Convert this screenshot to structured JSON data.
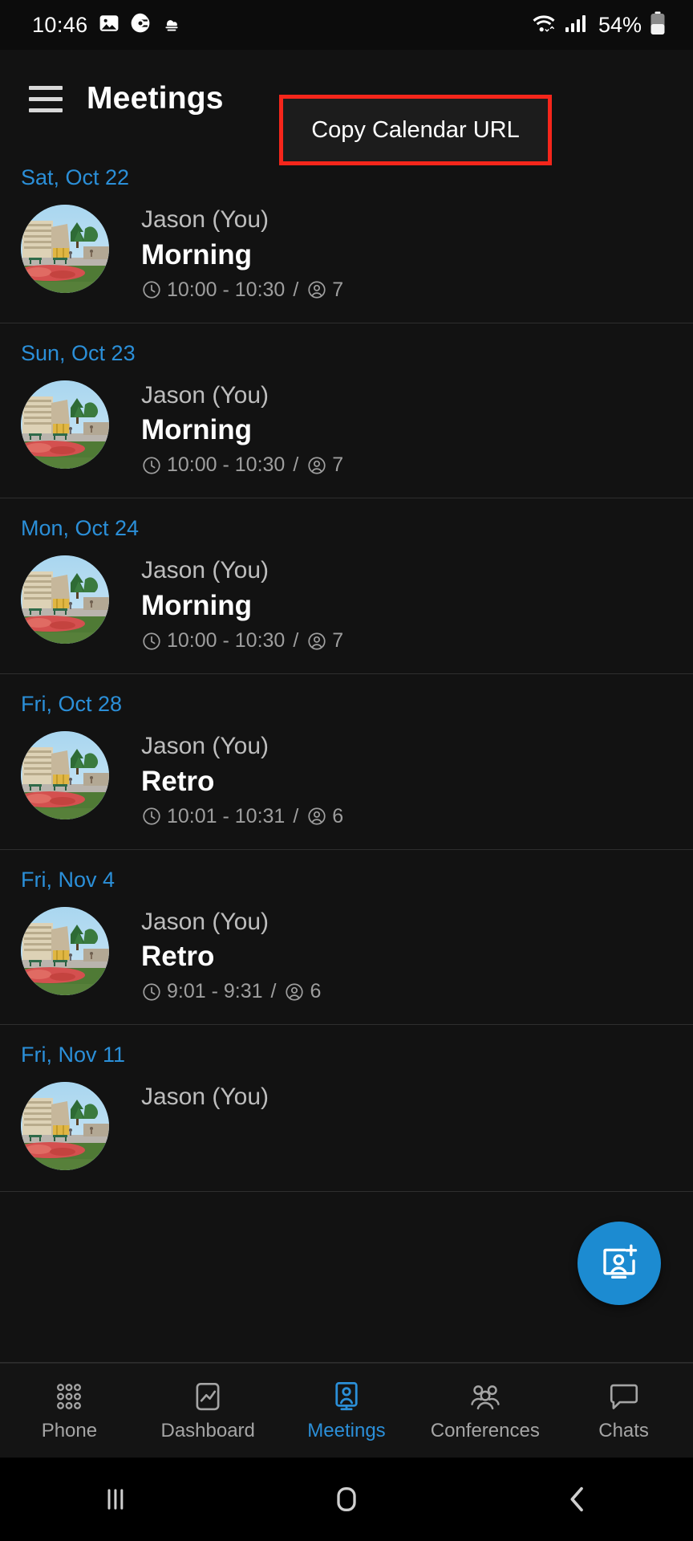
{
  "status_bar": {
    "time": "10:46",
    "battery_percent": "54%",
    "left_icons": [
      "image-icon",
      "chrome-icon",
      "cloud-icon"
    ],
    "right_icons": [
      "wifi-icon",
      "cellular-signal-icon",
      "battery-icon"
    ]
  },
  "app_bar": {
    "menu_icon": "hamburger-menu-icon",
    "title": "Meetings",
    "copy_calendar_url_label": "Copy Calendar URL",
    "highlight_color": "#f5261b"
  },
  "colors": {
    "accent": "#2b8fd8",
    "background": "#121212",
    "card": "#1c1c1c",
    "fab": "#1c8bd1",
    "divider": "#2e2e2e"
  },
  "meetings": [
    {
      "date": "Sat, Oct 22",
      "organizer": "Jason (You)",
      "subject": "Morning",
      "time": "10:00 - 10:30",
      "separator": "/",
      "participants": "7"
    },
    {
      "date": "Sun, Oct 23",
      "organizer": "Jason (You)",
      "subject": "Morning",
      "time": "10:00 - 10:30",
      "separator": "/",
      "participants": "7"
    },
    {
      "date": "Mon, Oct 24",
      "organizer": "Jason (You)",
      "subject": "Morning",
      "time": "10:00 - 10:30",
      "separator": "/",
      "participants": "7"
    },
    {
      "date": "Fri, Oct 28",
      "organizer": "Jason (You)",
      "subject": "Retro",
      "time": "10:01 - 10:31",
      "separator": "/",
      "participants": "6"
    },
    {
      "date": "Fri, Nov 4",
      "organizer": "Jason (You)",
      "subject": "Retro",
      "time": "9:01 - 9:31",
      "separator": "/",
      "participants": "6"
    },
    {
      "date": "Fri, Nov 11",
      "organizer": "Jason (You)",
      "subject": "",
      "time": "",
      "separator": "",
      "participants": ""
    }
  ],
  "fab": {
    "icon": "add-meeting-icon"
  },
  "bottom_nav": {
    "items": [
      {
        "label": "Phone",
        "icon": "dialpad-icon",
        "active": false
      },
      {
        "label": "Dashboard",
        "icon": "chart-icon",
        "active": false
      },
      {
        "label": "Meetings",
        "icon": "meeting-screen-icon",
        "active": true
      },
      {
        "label": "Conferences",
        "icon": "group-people-icon",
        "active": false
      },
      {
        "label": "Chats",
        "icon": "speech-bubble-icon",
        "active": false
      }
    ]
  },
  "system_nav": {
    "recents_label": "|||",
    "home_label": "home-icon",
    "back_label": "back-icon"
  }
}
